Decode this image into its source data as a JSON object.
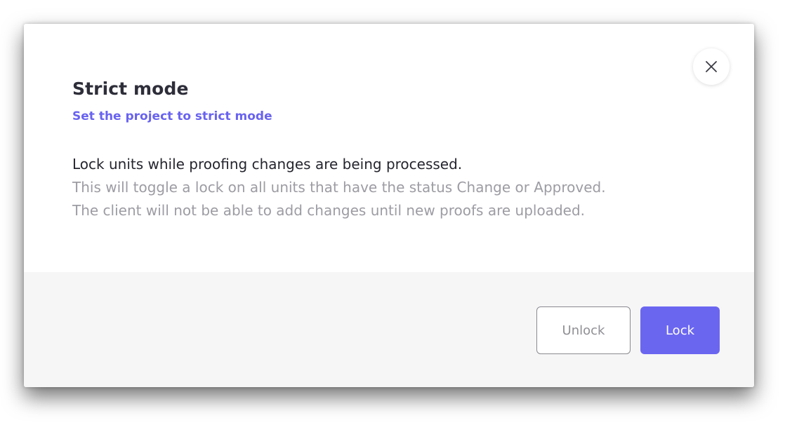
{
  "dialog": {
    "title": "Strict mode",
    "subtitle": "Set the project to strict mode",
    "description_lead": "Lock units while proofing changes are being processed.",
    "description_lines": [
      "This will toggle a lock on all units that have the status Change or Approved.",
      "The client will not be able to add changes until new proofs are uploaded."
    ],
    "close_icon": "close-icon"
  },
  "footer": {
    "unlock_label": "Unlock",
    "lock_label": "Lock"
  },
  "colors": {
    "accent": "#6b66f0",
    "subtitle": "#6963ef",
    "footer_bg": "#f6f6f7",
    "muted_text": "#9c9ca3"
  }
}
